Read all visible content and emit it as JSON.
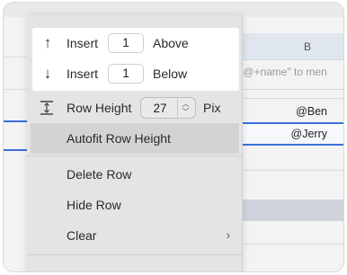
{
  "background": {
    "column_letter": "B",
    "hint_text": "\"@+name\" to men",
    "cells": [
      "@Ben",
      "@Jerry"
    ]
  },
  "menu": {
    "insert_above": {
      "label": "Insert",
      "value": "1",
      "suffix": "Above",
      "icon": "arrow-up-icon"
    },
    "insert_below": {
      "label": "Insert",
      "value": "1",
      "suffix": "Below",
      "icon": "arrow-down-icon"
    },
    "row_height": {
      "label": "Row Height",
      "value": "27",
      "unit": "Pix",
      "icon": "row-height-icon"
    },
    "autofit": {
      "label": "Autofit Row Height"
    },
    "delete_row": {
      "label": "Delete Row"
    },
    "hide_row": {
      "label": "Hide Row"
    },
    "clear": {
      "label": "Clear",
      "icon": "chevron-right-icon"
    }
  },
  "colors": {
    "selection_blue": "#3b6fd8",
    "menu_bg": "#e4e4e4",
    "highlight": "#d3d3d3"
  }
}
